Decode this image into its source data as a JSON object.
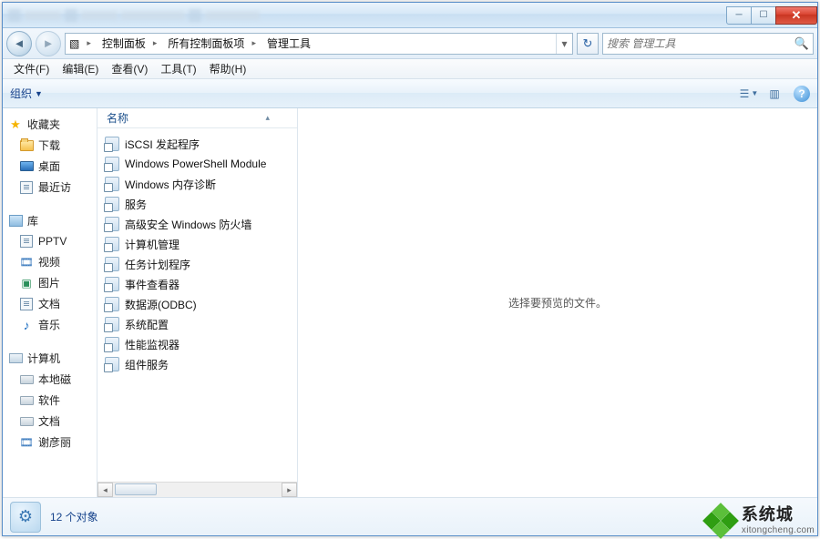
{
  "titlebar": {
    "minimize": "─",
    "maximize": "☐",
    "close": "✕"
  },
  "breadcrumb": {
    "seg1": "控制面板",
    "seg2": "所有控制面板项",
    "seg3": "管理工具"
  },
  "search": {
    "placeholder": "搜索 管理工具"
  },
  "menu": {
    "file": "文件(F)",
    "edit": "编辑(E)",
    "view": "查看(V)",
    "tools": "工具(T)",
    "help": "帮助(H)"
  },
  "toolbar": {
    "organize": "组织"
  },
  "sidebar": {
    "favorites": "收藏夹",
    "downloads": "下载",
    "desktop": "桌面",
    "recent": "最近访",
    "library": "库",
    "pptv": "PPTV",
    "video": "视频",
    "pictures": "图片",
    "documents": "文档",
    "music": "音乐",
    "computer": "计算机",
    "localdisk": "本地磁",
    "software": "软件",
    "docs2": "文档",
    "xieyan": "谢彦丽"
  },
  "list": {
    "header_name": "名称",
    "items": [
      "iSCSI 发起程序",
      "Windows PowerShell Module",
      "Windows 内存诊断",
      "服务",
      "高级安全 Windows 防火墙",
      "计算机管理",
      "任务计划程序",
      "事件查看器",
      "数据源(ODBC)",
      "系统配置",
      "性能监视器",
      "组件服务"
    ]
  },
  "preview": {
    "empty": "选择要预览的文件。"
  },
  "status": {
    "count": "12 个对象"
  },
  "watermark": {
    "brand": "系统城",
    "url": "xitongcheng.com"
  }
}
